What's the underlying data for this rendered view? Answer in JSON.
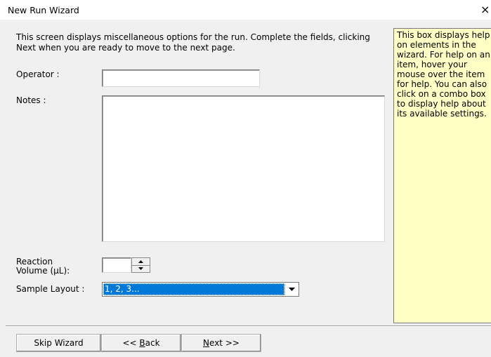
{
  "window": {
    "title": "New Run Wizard",
    "close_glyph": "×"
  },
  "intro": "This screen displays miscellaneous options for the run. Complete the fields, clicking Next when you are ready to move to the next page.",
  "fields": {
    "operator_label": "Operator :",
    "operator_value": "",
    "notes_label": "Notes :",
    "notes_value": "",
    "reaction_volume_label_1": "Reaction",
    "reaction_volume_label_2": "Volume (µL):",
    "reaction_volume_value": "",
    "sample_layout_label": "Sample Layout :",
    "sample_layout_value": "1, 2, 3..."
  },
  "help": {
    "text": "This box displays help on elements in the wizard. For help on an item, hover your mouse over the item for help. You can also click on a combo box to display help about its available settings."
  },
  "buttons": {
    "skip": "Skip Wizard",
    "back_prefix": "<< ",
    "back_accel": "B",
    "back_rest": "ack",
    "next_accel": "N",
    "next_rest": "ext >>"
  },
  "colors": {
    "help_bg": "#ffffc6",
    "selection": "#0078d7",
    "dialog_bg": "#f0f0f0"
  },
  "icons": {
    "close": "close-icon",
    "spin_up": "spin-up-icon",
    "spin_down": "spin-down-icon",
    "dropdown": "chevron-down-icon"
  }
}
